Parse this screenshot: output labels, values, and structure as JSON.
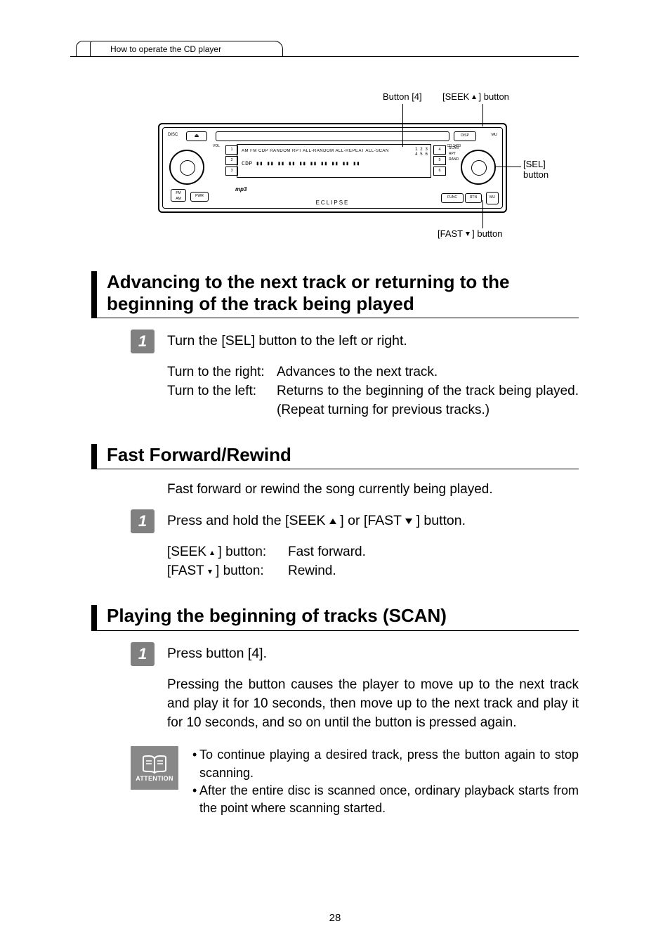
{
  "breadcrumb": "How to operate the CD player",
  "page_number": "28",
  "diagram": {
    "callouts": {
      "button4": "Button [4]",
      "seek": {
        "prefix": "[SEEK ",
        "suffix": " ] button"
      },
      "sel": "[SEL]\nbutton",
      "fast": {
        "prefix": "[FAST ",
        "suffix": " ] button"
      }
    },
    "eject_label": "DISC",
    "slot_right": "DISP",
    "mu": "MU",
    "vol": "VOL",
    "model": "CD 3403",
    "screen": {
      "line1": "AM  FM  CDP  RANDOM  RPT  ALL-RANDOM  ALL-REPEAT  ALL-SCAN",
      "line2": "CDP  ▮▮ ▮▮ ▮▮ ▮▮ ▮▮ ▮▮ ▮▮ ▮▮ ▮▮ ▮▮",
      "nums": "1 2 3\n4 5 6"
    },
    "left_col": [
      "1",
      "2",
      "3"
    ],
    "right_col": [
      "4",
      "5",
      "6"
    ],
    "right_labels": "SCAN\nRPT\nRAND",
    "fm": "FM",
    "am": "AM",
    "pwr": "PWR",
    "mp3": "mp3",
    "brand": "ECLIPSE",
    "func": "FUNC",
    "rtn": "RTN",
    "corner_mu": "MU"
  },
  "sections": {
    "advance": {
      "heading": "Advancing to the next track or returning to the beginning of the track being played",
      "step_number": "1",
      "step_title": "Turn the [SEL] button to the left or right.",
      "rows": [
        {
          "label": "Turn to the right:",
          "value": "Advances to the next track."
        },
        {
          "label": "Turn to the left:",
          "value": "Returns to the beginning of the track being played. (Repeat turning for previous tracks.)"
        }
      ]
    },
    "ff": {
      "heading": "Fast Forward/Rewind",
      "intro": "Fast forward or rewind the song currently being played.",
      "step_number": "1",
      "step_title_pre": "Press and hold the [SEEK ",
      "step_title_mid": " ] or [FAST ",
      "step_title_post": " ] button.",
      "rows": [
        {
          "label_pre": "[SEEK ",
          "label_post": " ] button:",
          "value": "Fast forward."
        },
        {
          "label_pre": "[FAST ",
          "label_post": " ] button:",
          "value": "Rewind."
        }
      ]
    },
    "scan": {
      "heading": "Playing the beginning of tracks (SCAN)",
      "step_number": "1",
      "step_title": "Press button [4].",
      "body": "Pressing the button causes the player to move up to the next track and play it for 10 seconds, then move up to the next track and play it for 10 seconds, and so on until the button is pressed again.",
      "attention_label": "ATTENTION",
      "attention_items": [
        "To continue playing a desired track, press the button again to stop scanning.",
        "After the entire disc is scanned once, ordinary playback starts from the point where scanning started."
      ]
    }
  }
}
